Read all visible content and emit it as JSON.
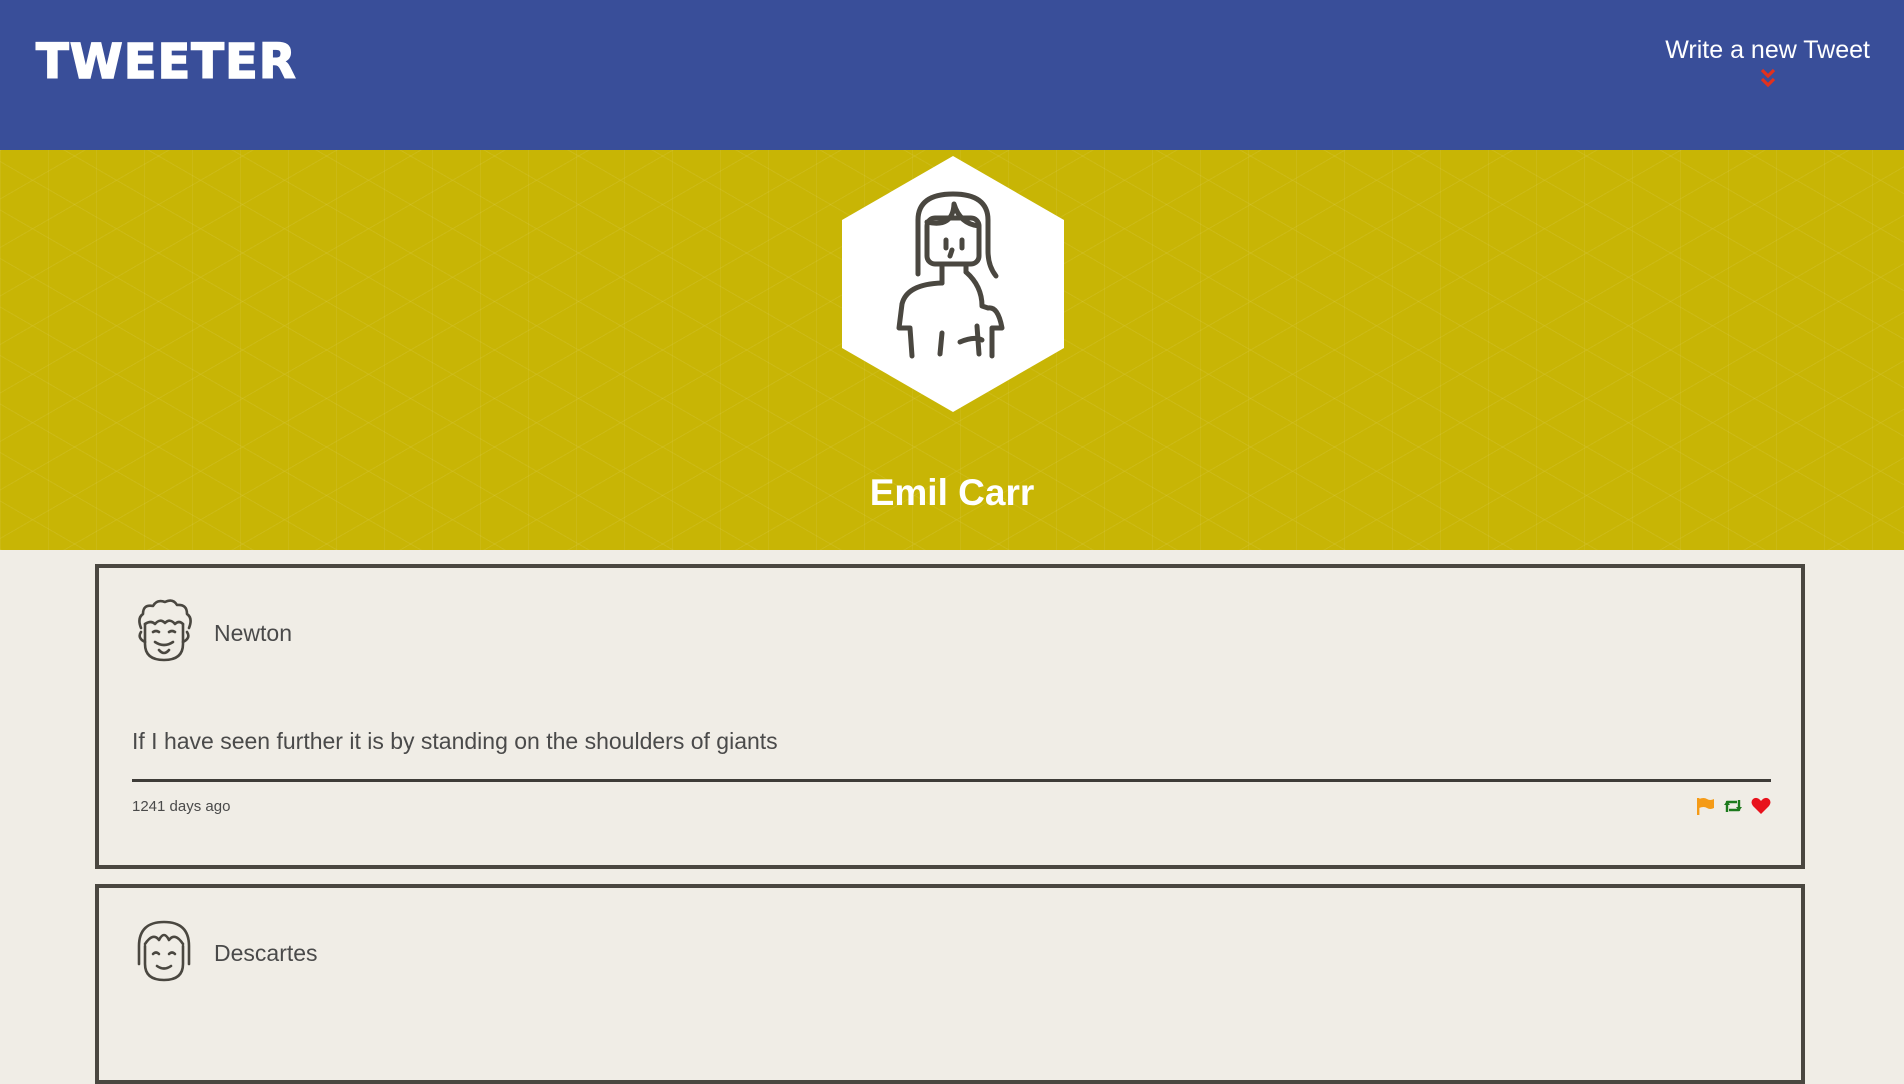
{
  "header": {
    "logo": "TWEETER",
    "compose_label": "Write a new Tweet"
  },
  "profile": {
    "name": "Emil Carr"
  },
  "tweets": [
    {
      "author": "Newton",
      "content": "If I have seen further it is by standing on the shoulders of giants",
      "time": "1241 days ago",
      "actions": [
        "flag-icon",
        "retweet-icon",
        "heart-icon"
      ]
    },
    {
      "author": "Descartes",
      "content": "",
      "time": "",
      "actions": []
    }
  ],
  "colors": {
    "header": "#394e99",
    "banner": "#c8b505",
    "background": "#f0ede6",
    "compose_chevron": "#e2311d",
    "flag": "#f59b17",
    "retweet": "#1d7a1d",
    "heart": "#e8121c"
  }
}
